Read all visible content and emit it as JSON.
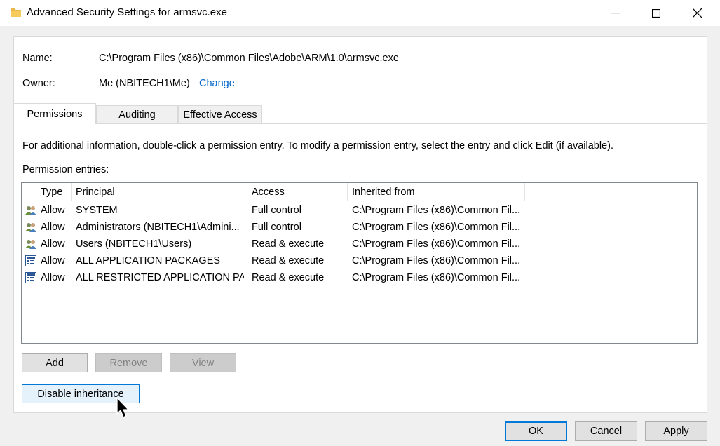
{
  "window": {
    "title": "Advanced Security Settings for armsvc.exe"
  },
  "info": {
    "name_label": "Name:",
    "name_value": "C:\\Program Files (x86)\\Common Files\\Adobe\\ARM\\1.0\\armsvc.exe",
    "owner_label": "Owner:",
    "owner_value": "Me (NBITECH1\\Me)",
    "change_link": "Change"
  },
  "tabs": [
    {
      "label": "Permissions",
      "active": true
    },
    {
      "label": "Auditing",
      "active": false
    },
    {
      "label": "Effective Access",
      "active": false
    }
  ],
  "instructions": "For additional information, double-click a permission entry. To modify a permission entry, select the entry and click Edit (if available).",
  "entries_label": "Permission entries:",
  "table": {
    "columns": [
      "Type",
      "Principal",
      "Access",
      "Inherited from"
    ],
    "rows": [
      {
        "icon": "user-group-icon",
        "type": "Allow",
        "principal": "SYSTEM",
        "access": "Full control",
        "inherited": "C:\\Program Files (x86)\\Common Fil..."
      },
      {
        "icon": "user-group-icon",
        "type": "Allow",
        "principal": "Administrators (NBITECH1\\Admini...",
        "access": "Full control",
        "inherited": "C:\\Program Files (x86)\\Common Fil..."
      },
      {
        "icon": "user-group-icon",
        "type": "Allow",
        "principal": "Users (NBITECH1\\Users)",
        "access": "Read & execute",
        "inherited": "C:\\Program Files (x86)\\Common Fil..."
      },
      {
        "icon": "app-package-icon",
        "type": "Allow",
        "principal": "ALL APPLICATION PACKAGES",
        "access": "Read & execute",
        "inherited": "C:\\Program Files (x86)\\Common Fil..."
      },
      {
        "icon": "app-package-icon",
        "type": "Allow",
        "principal": "ALL RESTRICTED APPLICATION PA...",
        "access": "Read & execute",
        "inherited": "C:\\Program Files (x86)\\Common Fil..."
      }
    ]
  },
  "buttons": {
    "add": "Add",
    "remove": "Remove",
    "view": "View",
    "disable_inheritance": "Disable inheritance",
    "ok": "OK",
    "cancel": "Cancel",
    "apply": "Apply"
  }
}
